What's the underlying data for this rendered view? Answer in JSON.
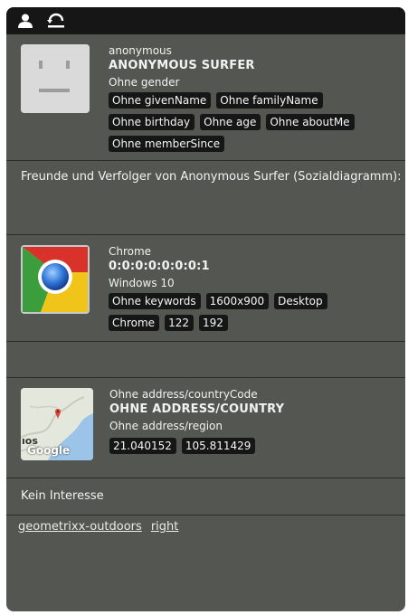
{
  "user": {
    "login": "anonymous",
    "name": "ANONYMOUS SURFER",
    "gender": "Ohne gender",
    "tags": [
      "Ohne givenName",
      "Ohne familyName",
      "Ohne birthday",
      "Ohne age",
      "Ohne aboutMe",
      "Ohne memberSince"
    ]
  },
  "social": {
    "text": "Freunde und Verfolger von Anonymous Surfer (Sozialdiagramm):"
  },
  "browser": {
    "name": "Chrome",
    "ip": "0:0:0:0:0:0:0:1",
    "os": "Windows 10",
    "tags": [
      "Ohne keywords",
      "1600x900",
      "Desktop",
      "Chrome",
      "122",
      "192"
    ]
  },
  "geo": {
    "country_code": "Ohne address/countryCode",
    "country": "OHNE ADDRESS/COUNTRY",
    "region": "Ohne address/region",
    "tags": [
      "21.040152",
      "105.811429"
    ],
    "map_text_os": "ıos",
    "map_text_google": "Google"
  },
  "interest": {
    "text": "Kein Interesse"
  },
  "footer": {
    "links": [
      "geometrixx-outdoors",
      "right"
    ]
  },
  "icons": {
    "toolbar": [
      "user-icon",
      "revert-icon"
    ]
  }
}
